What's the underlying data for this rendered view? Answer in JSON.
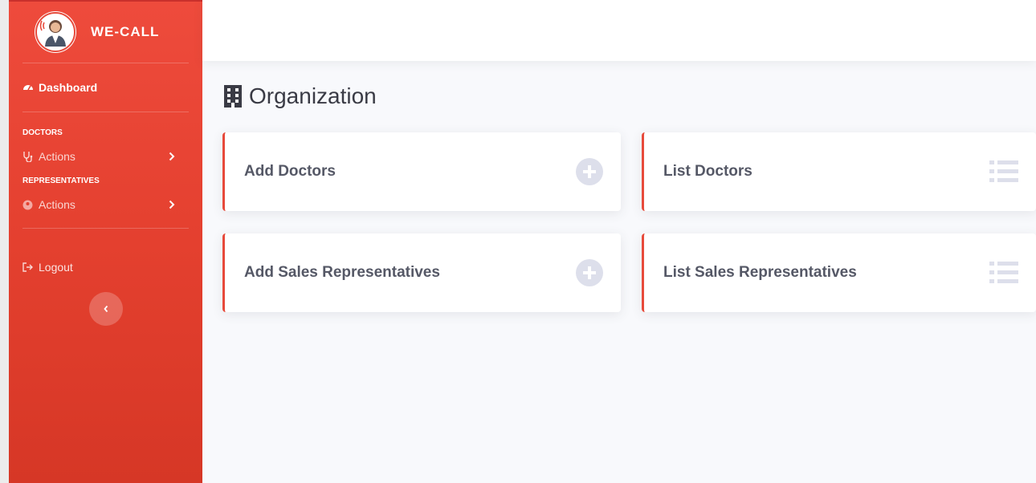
{
  "brand": {
    "name": "WE-CALL"
  },
  "sidebar": {
    "dashboard_label": "Dashboard",
    "sections": [
      {
        "heading": "DOCTORS",
        "item_label": "Actions"
      },
      {
        "heading": "REPRESENTATIVES",
        "item_label": "Actions"
      }
    ],
    "logout_label": "Logout"
  },
  "page": {
    "title": "Organization"
  },
  "cards": [
    {
      "label": "Add Doctors",
      "icon": "plus-circle-icon"
    },
    {
      "label": "List Doctors",
      "icon": "list-icon"
    },
    {
      "label": "Add Sales Representatives",
      "icon": "plus-circle-icon"
    },
    {
      "label": "List Sales Representatives",
      "icon": "list-icon"
    }
  ],
  "colors": {
    "sidebar_accent": "#e74a3b",
    "card_border": "#e74a3b",
    "icon_muted": "#dddfeb",
    "title_text": "#3a3b45"
  }
}
